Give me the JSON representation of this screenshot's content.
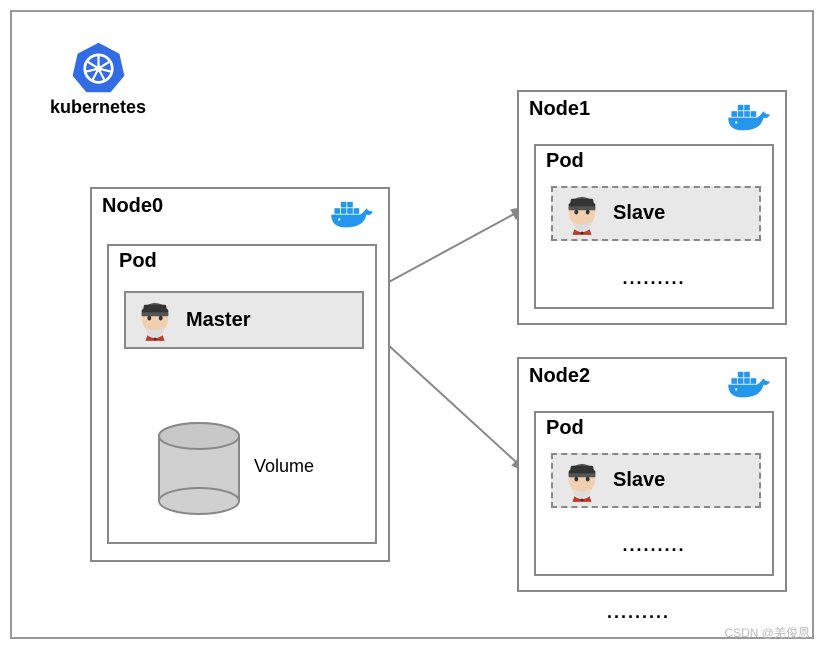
{
  "brand": {
    "label": "kubernetes"
  },
  "node0": {
    "title": "Node0",
    "pod": "Pod",
    "role": "Master",
    "volume": "Volume"
  },
  "node1": {
    "title": "Node1",
    "pod": "Pod",
    "role": "Slave",
    "dots": "........."
  },
  "node2": {
    "title": "Node2",
    "pod": "Pod",
    "role": "Slave",
    "dots": "........."
  },
  "nodes_dots": ".........",
  "watermark": "CSDN @羌俊恩"
}
